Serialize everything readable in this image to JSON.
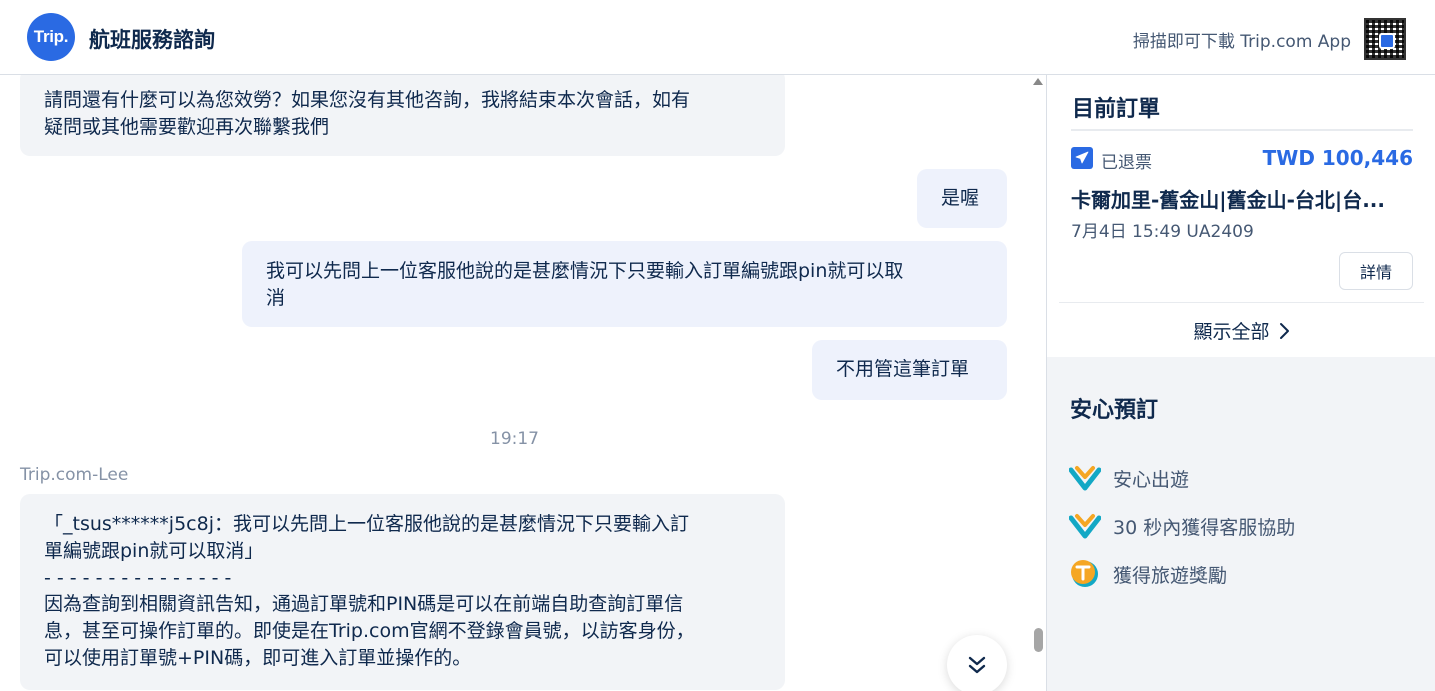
{
  "header": {
    "logo_text": "Trip.",
    "title": "航班服務諮詢",
    "download_text": "掃描即可下載 Trip.com App",
    "brand_color": "#2a6ae3"
  },
  "chat": {
    "messages": [
      {
        "from": "agent",
        "lines": [
          "請問還有什麼可以為您效勞？如果您沒有其他咨詢，我將結束本次會話，如有",
          "疑問或其他需要歡迎再次聯繫我們"
        ]
      },
      {
        "from": "user",
        "lines": [
          "是喔"
        ]
      },
      {
        "from": "user",
        "lines": [
          "我可以先問上一位客服他說的是甚麼情況下只要輸入訂單編號跟pin就可以取",
          "消"
        ]
      },
      {
        "from": "user",
        "lines": [
          "不用管這筆訂單"
        ]
      },
      {
        "from": "agent",
        "lines": [
          "「_tsus******j5c8j：我可以先問上一位客服他說的是甚麼情況下只要輸入訂",
          "單編號跟pin就可以取消」",
          "- - - - - - - - - - - - - - -",
          "因為查詢到相關資訊告知，通過訂單號和PIN碼是可以在前端自助查詢訂單信",
          "息，甚至可操作訂單的。即使是在Trip.com官網不登錄會員號，以訪客身份，",
          "可以使用訂單號+PIN碼，即可進入訂單並操作的。"
        ]
      }
    ],
    "timestamp": "19:17",
    "agent_name": "Trip.com-Lee"
  },
  "orders": {
    "title": "目前訂單",
    "status": "已退票",
    "price": "TWD 100,446",
    "route": "卡爾加里-舊金山|舊金山-台北|台...",
    "flight_info": "7月4日 15:49 UA2409",
    "detail_label": "詳情",
    "show_all_label": "顯示全部"
  },
  "safe": {
    "title": "安心預訂",
    "items": [
      {
        "icon": "heart-check-icon",
        "label": "安心出遊"
      },
      {
        "icon": "heart-check-icon",
        "label": "30 秒內獲得客服協助"
      },
      {
        "icon": "trip-coin-icon",
        "label": "獲得旅遊獎勵"
      }
    ]
  }
}
